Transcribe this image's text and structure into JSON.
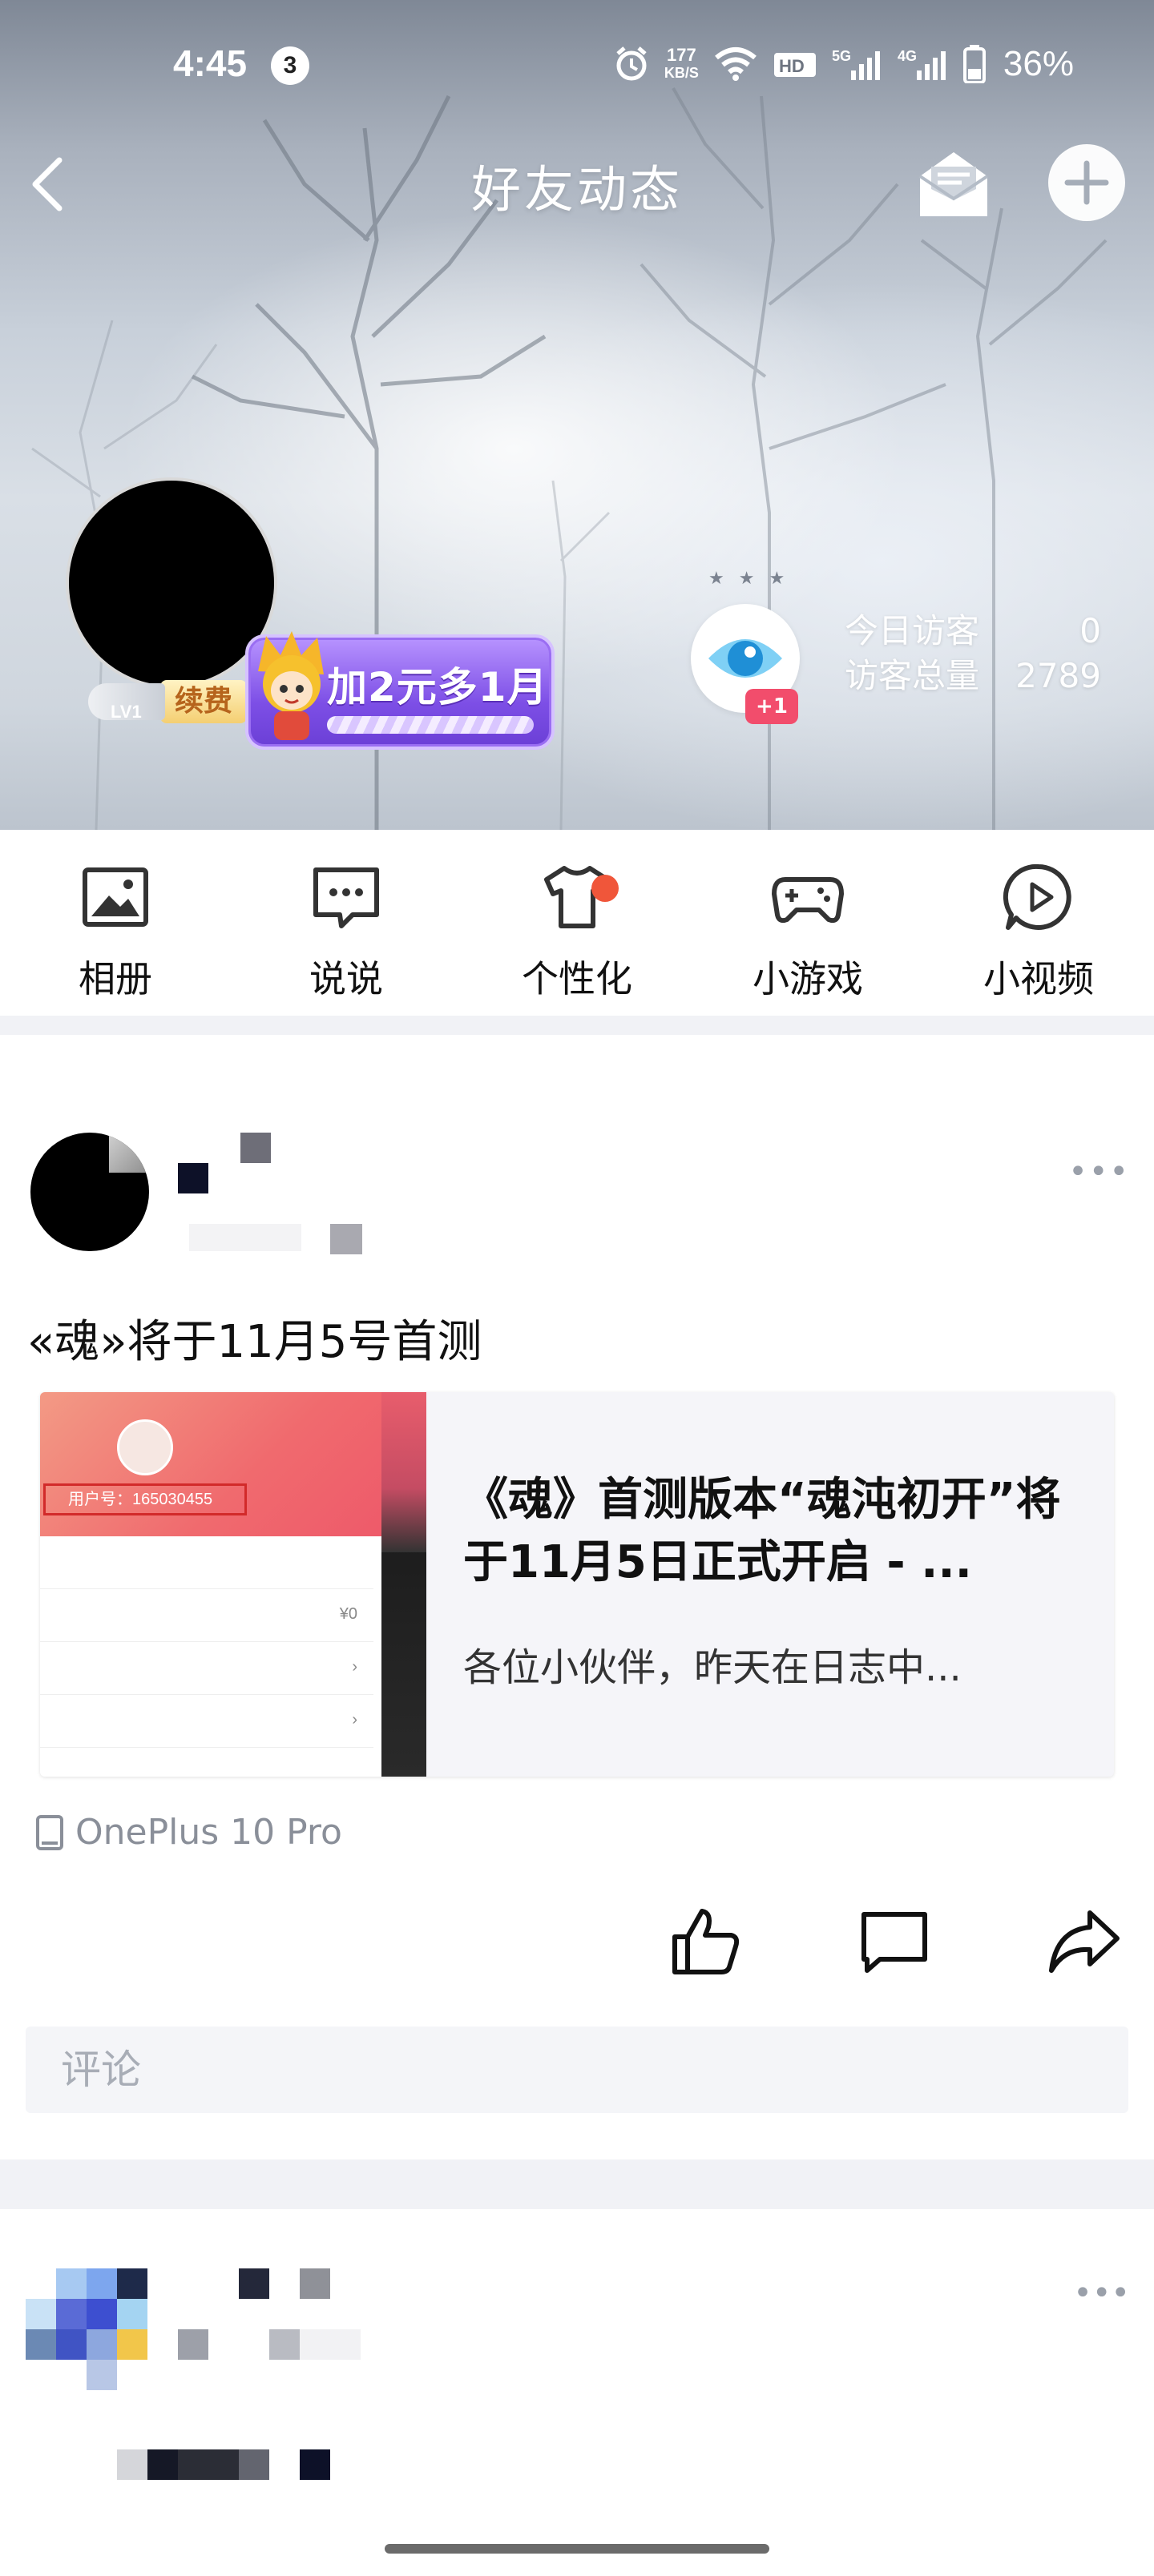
{
  "status_bar": {
    "time": "4:45",
    "notification_count": "3",
    "net_speed_value": "177",
    "net_speed_unit": "KB/S",
    "battery_percent": "36%"
  },
  "nav": {
    "title": "好友动态"
  },
  "profile": {
    "level": "LV1",
    "renew_label": "续费",
    "vip_promo_text": "加2元多1月",
    "visitor_plus": "+1",
    "today_visitors_label": "今日访客",
    "today_visitors_value": "0",
    "total_visitors_label": "访客总量",
    "total_visitors_value": "2789"
  },
  "shortcuts": [
    {
      "label": "相册",
      "icon": "photo-album-icon"
    },
    {
      "label": "说说",
      "icon": "chat-bubble-icon"
    },
    {
      "label": "个性化",
      "icon": "tshirt-icon",
      "badge": true
    },
    {
      "label": "小游戏",
      "icon": "gamepad-icon"
    },
    {
      "label": "小视频",
      "icon": "play-circle-icon"
    }
  ],
  "post": {
    "text": "«魂»将于11月5号首测",
    "link_title": "《魂》首测版本“魂沌初开”将于11月5日正式开启 - ...",
    "link_desc": "各位小伙伴，昨天在日志中...",
    "thumb_user_id": "用户号：165030455",
    "thumb_price": "¥0",
    "device": "OnePlus 10 Pro",
    "comment_placeholder": "评论"
  },
  "colors": {
    "accent_red": "#f0563a",
    "vip_purple": "#7d4fe6",
    "badge_pink": "#f24d6c"
  }
}
